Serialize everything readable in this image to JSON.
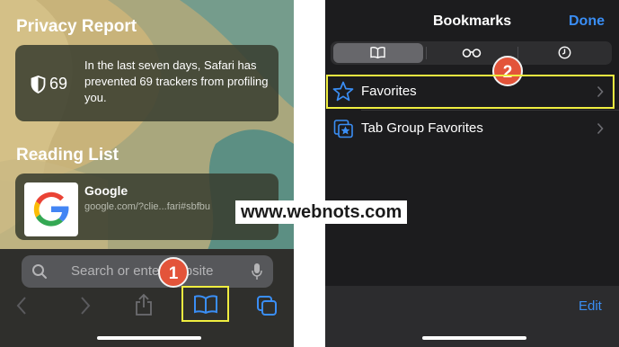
{
  "left": {
    "privacy_report": {
      "title": "Privacy Report",
      "count": "69",
      "text": "In the last seven days, Safari has prevented 69 trackers from profiling you."
    },
    "reading_list": {
      "title": "Reading List",
      "item": {
        "title": "Google",
        "url": "google.com/?clie...fari#sbfbu"
      }
    },
    "search_placeholder": "Search or enter website",
    "toolbar_icons": [
      "back-chevron-icon",
      "forward-chevron-icon",
      "share-icon",
      "bookmarks-book-icon",
      "tabs-icon"
    ],
    "badge": "1"
  },
  "right": {
    "title": "Bookmarks",
    "done": "Done",
    "segments": [
      "book-icon",
      "glasses-icon",
      "clock-icon"
    ],
    "rows": [
      {
        "label": "Favorites",
        "icon": "star-icon"
      },
      {
        "label": "Tab Group Favorites",
        "icon": "star-folder-icon"
      }
    ],
    "edit": "Edit",
    "badge": "2"
  },
  "watermark": "www.webnots.com",
  "colors": {
    "highlight": "#f0ee40",
    "badge": "#e3543a",
    "accent": "#3a8ef5"
  }
}
